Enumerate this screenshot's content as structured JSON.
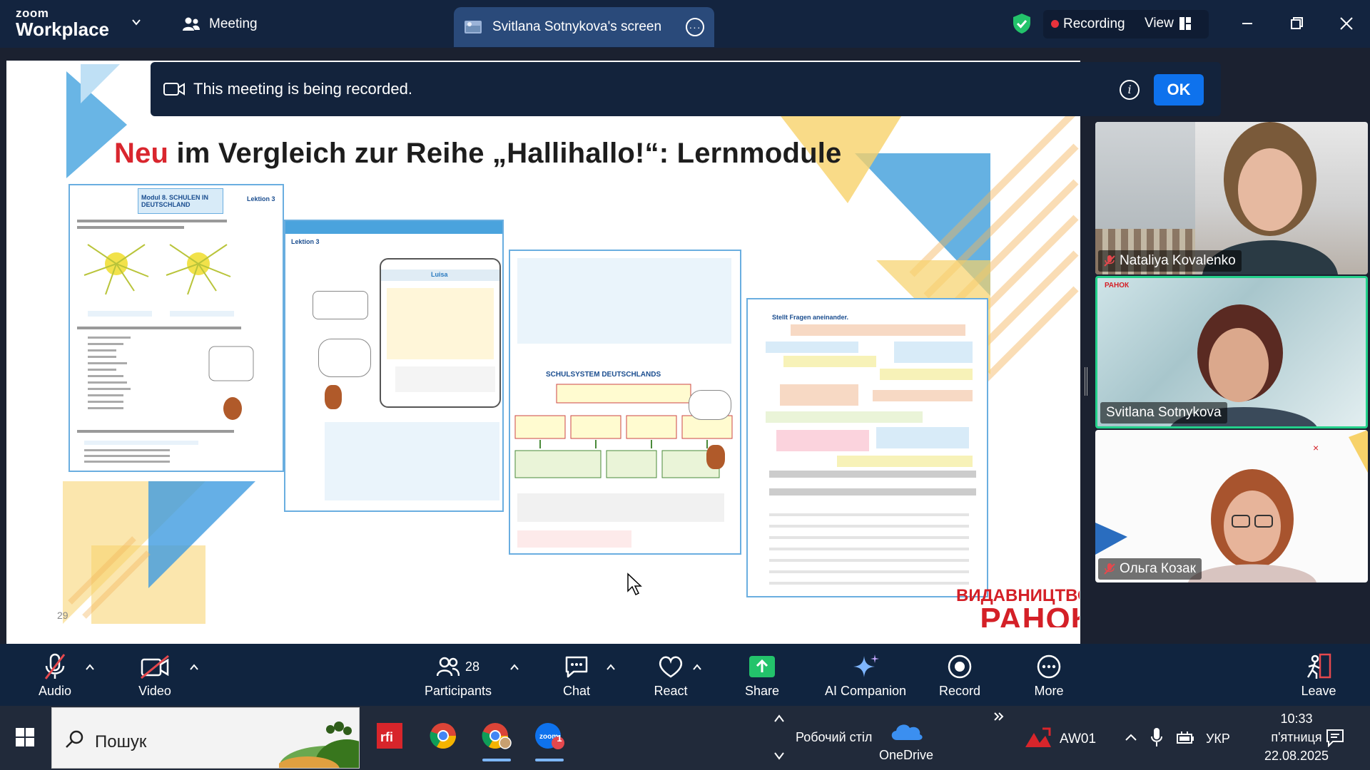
{
  "app": {
    "logo_line1": "zoom",
    "logo_line2": "Workplace",
    "meeting_tab": "Meeting",
    "share_tab": "Svitlana Sotnykova's screen",
    "recording_label": "Recording",
    "view_label": "View"
  },
  "banner": {
    "message": "This meeting is being recorded.",
    "ok_label": "OK"
  },
  "slide": {
    "title_highlight": "Neu",
    "title_rest": " im Vergleich zur Reihe „Hallihallo!“: Lernmodule",
    "page_number": "29",
    "publisher_line1": "ВИДАВНИЦТВО",
    "publisher_line2": "РАНОК",
    "book1_header": "Modul 8. SCHULEN IN DEUTSCHLAND",
    "book1_lesson": "Lektion 3",
    "book2_lesson": "Lektion 3",
    "book2_phone_name": "Luisa",
    "book3_heading": "SCHULSYSTEM DEUTSCHLANDS",
    "book4_heading": "Stellt Fragen aneinander."
  },
  "participants": [
    {
      "name": "Nataliya Kovalenko",
      "muted": true
    },
    {
      "name": "Svitlana Sotnykova",
      "muted": false,
      "active": true
    },
    {
      "name": "Ольга Козак",
      "muted": true
    }
  ],
  "toolbar": {
    "audio": "Audio",
    "video": "Video",
    "participants": "Participants",
    "participants_count": "28",
    "chat": "Chat",
    "react": "React",
    "share": "Share",
    "ai_companion": "AI Companion",
    "record": "Record",
    "more": "More",
    "leave": "Leave"
  },
  "taskbar": {
    "search_placeholder": "Пошук",
    "desktop_label": "Робочий стіл",
    "onedrive_label": "OneDrive",
    "aw_label": "AW01",
    "lang": "УКР",
    "time": "10:33",
    "day": "п'ятниця",
    "date": "22.08.2025",
    "zoom_badge": "1"
  },
  "colors": {
    "accent": "#0e72ed",
    "record_dot": "#e8323c",
    "active_speaker": "#23d18b",
    "share_green": "#23c36b",
    "leave_red": "#e5484d"
  }
}
